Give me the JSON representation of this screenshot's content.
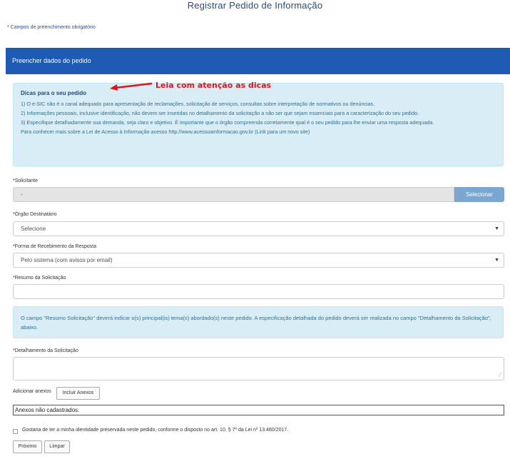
{
  "page": {
    "title": "Registrar Pedido de Informação",
    "required_note": "* Campos de preenchimento obrigatório"
  },
  "panel": {
    "heading": "Preencher dados do pedido"
  },
  "tips": {
    "heading": "Dicas para o seu pedido",
    "items": [
      "1) O e-SIC não é o canal adequado para apresentação de reclamações, solicitação de serviços, consultas sobre interpretação de normativos ou denúncias.",
      "2) Informações pessoais, inclusive identificação, não devem ser inseridas no detalhamento da solicitação a não ser que sejam essenciais para a caracterização do seu pedido.",
      "3) Especifique detalhadamente sua demanda, seja claro e objetivo. É importante que o órgão compreenda corretamente qual é o seu pedido para lhe enviar uma resposta adequada.",
      "Para conhecer mais sobre a Lei de Acesso à Informação acesso http://www.acessoainformacao.gov.br (Link para um novo site)"
    ]
  },
  "annotation": {
    "text": "Leia com atenção as dicas",
    "color": "#e0151b"
  },
  "form": {
    "solicitante_label": "*Solicitante",
    "solicitante_value": "-",
    "selecionar_button": "Selecionar",
    "orgao_label": "*Órgão Destinatário",
    "orgao_value": "Selecione",
    "forma_label": "*Forma de Recebimento da Resposta",
    "forma_value": "Pelo sistema (com avisos por email)",
    "resumo_label": "*Resumo da Solicitação",
    "resumo_value": "",
    "resumo_info": "O campo \"Resumo Solicitação\" deverá indicar o(s) principal(is) tema(s) abordado(s) neste pedido. A especificação detalhada do pedido deverá ser realizada no campo \"Detalhamento da Solicitação\", abaixo.",
    "detalhamento_label": "*Detalhamento da Solicitação",
    "detalhamento_value": "",
    "anexos_label": "Adicionar anexos",
    "incluir_anexos_button": "Incluir Anexos",
    "anexos_status": "Anexos não cadastrados.",
    "identity_checkbox_label": "Gostaria de ter a minha identidade preservada neste pedido, conforme o disposto no art. 10, § 7º da Lei nº 13.460/2017.",
    "identity_checked": false,
    "proximo_button": "Próximo",
    "limpar_button": "Limpar"
  },
  "icons": {
    "dropdown": "chevron-down-icon",
    "resize": "resize-grip-icon",
    "arrow": "red-arrow-icon"
  },
  "colors": {
    "panel_header": "#1f5bb5",
    "info_bg": "#d9edf7",
    "select_button": "#7aa6d2",
    "title": "#2c4a78"
  }
}
